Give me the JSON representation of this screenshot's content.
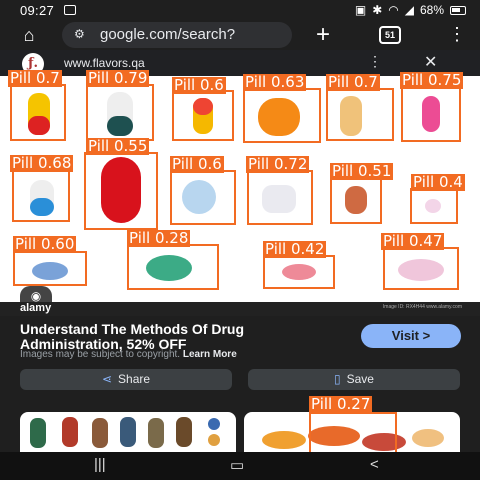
{
  "status": {
    "time": "09:27",
    "battery": "68%",
    "icons": [
      "gallery-icon",
      "lock-icon",
      "bluetooth-icon",
      "wifi-icon",
      "signal-icon"
    ]
  },
  "browser": {
    "url": "google.com/search?",
    "tab_count": "51"
  },
  "preview": {
    "site": "www.flavors.qa",
    "watermark": "alamy",
    "image_id": "Image ID: RX4H44 www.alamy.com",
    "detections": [
      {
        "label": "Pill 0.7"
      },
      {
        "label": "Pill 0.79"
      },
      {
        "label": "Pill 0.6"
      },
      {
        "label": "Pill 0.63"
      },
      {
        "label": "Pill 0.7"
      },
      {
        "label": "Pill 0.75"
      },
      {
        "label": "Pill 0.68"
      },
      {
        "label": "Pill 0.55"
      },
      {
        "label": "Pill 0.6"
      },
      {
        "label": "Pill 0.72"
      },
      {
        "label": "Pill 0.51"
      },
      {
        "label": "Pill 0.4"
      },
      {
        "label": "Pill 0.60"
      },
      {
        "label": "Pill 0.28"
      },
      {
        "label": "Pill 0.42"
      },
      {
        "label": "Pill 0.47"
      },
      {
        "label": "Pill 0.27"
      }
    ]
  },
  "result": {
    "title": "Understand The Methods Of Drug Administration, 52% OFF",
    "visit_label": "Visit >",
    "copyright": "Images may be subject to copyright.",
    "learn_more": "Learn More",
    "share_label": "Share",
    "save_label": "Save"
  },
  "colors": {
    "box": "#f26b22",
    "accent": "#8ab4f8",
    "bg": "#1f1f1f"
  }
}
